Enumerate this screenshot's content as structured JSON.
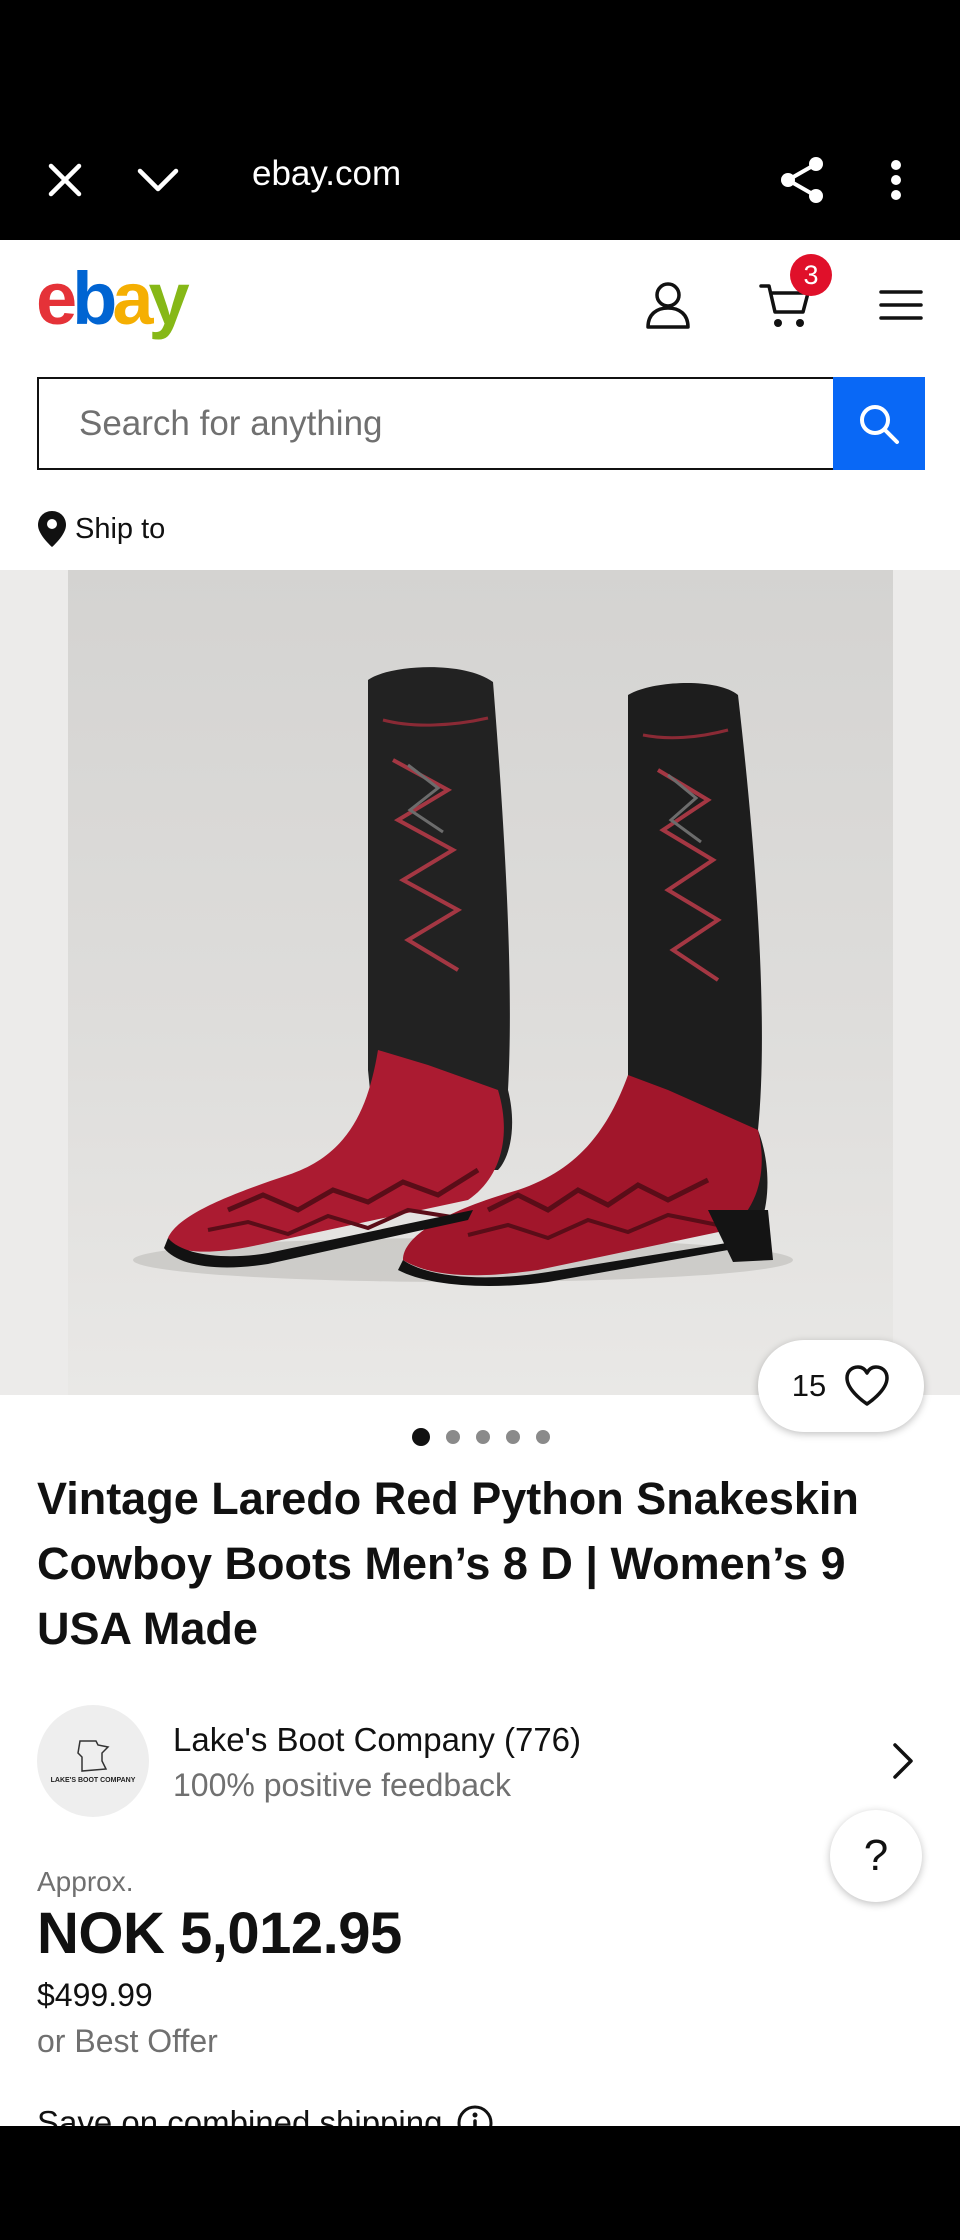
{
  "browser": {
    "url": "ebay.com",
    "icons": [
      "close-icon",
      "chevron-down-icon",
      "share-icon",
      "more-vert-icon"
    ]
  },
  "header": {
    "logo_letters": [
      {
        "char": "e",
        "color": "#e53238"
      },
      {
        "char": "b",
        "color": "#0064d2"
      },
      {
        "char": "a",
        "color": "#f5af02"
      },
      {
        "char": "y",
        "color": "#86b817"
      }
    ],
    "cart_count": "3",
    "icons": [
      "account-icon",
      "cart-icon",
      "hamburger-menu-icon"
    ]
  },
  "search": {
    "placeholder": "Search for anything"
  },
  "ship_to": {
    "label": "Ship to"
  },
  "gallery": {
    "image_count": 5,
    "current_index": 0,
    "watch_count": "15"
  },
  "listing": {
    "title": "Vintage Laredo Red Python Snakeskin Cowboy Boots Men’s 8 D | Women’s 9 USA Made"
  },
  "seller": {
    "logo_text": "LAKE'S BOOT COMPANY",
    "name": "Lake's Boot Company (776)",
    "feedback": "100% positive feedback"
  },
  "help": {
    "label": "?"
  },
  "price": {
    "approx_label": "Approx.",
    "converted": "NOK 5,012.95",
    "original": "$499.99",
    "offer": "or Best Offer"
  },
  "shipping": {
    "text": "Save on combined shipping"
  },
  "colors": {
    "accent_blue": "#0968f6",
    "badge_red": "#e0102a",
    "secondary_text": "#707070"
  }
}
